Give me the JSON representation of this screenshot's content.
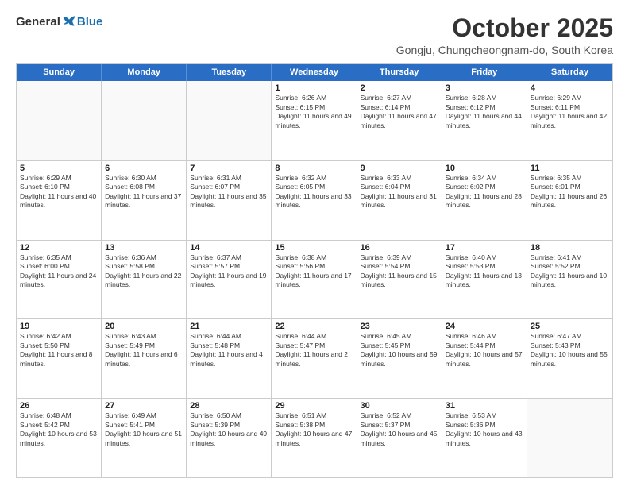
{
  "logo": {
    "general": "General",
    "blue": "Blue"
  },
  "title": "October 2025",
  "location": "Gongju, Chungcheongnam-do, South Korea",
  "header_days": [
    "Sunday",
    "Monday",
    "Tuesday",
    "Wednesday",
    "Thursday",
    "Friday",
    "Saturday"
  ],
  "weeks": [
    [
      {
        "day": "",
        "info": ""
      },
      {
        "day": "",
        "info": ""
      },
      {
        "day": "",
        "info": ""
      },
      {
        "day": "1",
        "info": "Sunrise: 6:26 AM\nSunset: 6:15 PM\nDaylight: 11 hours and 49 minutes."
      },
      {
        "day": "2",
        "info": "Sunrise: 6:27 AM\nSunset: 6:14 PM\nDaylight: 11 hours and 47 minutes."
      },
      {
        "day": "3",
        "info": "Sunrise: 6:28 AM\nSunset: 6:12 PM\nDaylight: 11 hours and 44 minutes."
      },
      {
        "day": "4",
        "info": "Sunrise: 6:29 AM\nSunset: 6:11 PM\nDaylight: 11 hours and 42 minutes."
      }
    ],
    [
      {
        "day": "5",
        "info": "Sunrise: 6:29 AM\nSunset: 6:10 PM\nDaylight: 11 hours and 40 minutes."
      },
      {
        "day": "6",
        "info": "Sunrise: 6:30 AM\nSunset: 6:08 PM\nDaylight: 11 hours and 37 minutes."
      },
      {
        "day": "7",
        "info": "Sunrise: 6:31 AM\nSunset: 6:07 PM\nDaylight: 11 hours and 35 minutes."
      },
      {
        "day": "8",
        "info": "Sunrise: 6:32 AM\nSunset: 6:05 PM\nDaylight: 11 hours and 33 minutes."
      },
      {
        "day": "9",
        "info": "Sunrise: 6:33 AM\nSunset: 6:04 PM\nDaylight: 11 hours and 31 minutes."
      },
      {
        "day": "10",
        "info": "Sunrise: 6:34 AM\nSunset: 6:02 PM\nDaylight: 11 hours and 28 minutes."
      },
      {
        "day": "11",
        "info": "Sunrise: 6:35 AM\nSunset: 6:01 PM\nDaylight: 11 hours and 26 minutes."
      }
    ],
    [
      {
        "day": "12",
        "info": "Sunrise: 6:35 AM\nSunset: 6:00 PM\nDaylight: 11 hours and 24 minutes."
      },
      {
        "day": "13",
        "info": "Sunrise: 6:36 AM\nSunset: 5:58 PM\nDaylight: 11 hours and 22 minutes."
      },
      {
        "day": "14",
        "info": "Sunrise: 6:37 AM\nSunset: 5:57 PM\nDaylight: 11 hours and 19 minutes."
      },
      {
        "day": "15",
        "info": "Sunrise: 6:38 AM\nSunset: 5:56 PM\nDaylight: 11 hours and 17 minutes."
      },
      {
        "day": "16",
        "info": "Sunrise: 6:39 AM\nSunset: 5:54 PM\nDaylight: 11 hours and 15 minutes."
      },
      {
        "day": "17",
        "info": "Sunrise: 6:40 AM\nSunset: 5:53 PM\nDaylight: 11 hours and 13 minutes."
      },
      {
        "day": "18",
        "info": "Sunrise: 6:41 AM\nSunset: 5:52 PM\nDaylight: 11 hours and 10 minutes."
      }
    ],
    [
      {
        "day": "19",
        "info": "Sunrise: 6:42 AM\nSunset: 5:50 PM\nDaylight: 11 hours and 8 minutes."
      },
      {
        "day": "20",
        "info": "Sunrise: 6:43 AM\nSunset: 5:49 PM\nDaylight: 11 hours and 6 minutes."
      },
      {
        "day": "21",
        "info": "Sunrise: 6:44 AM\nSunset: 5:48 PM\nDaylight: 11 hours and 4 minutes."
      },
      {
        "day": "22",
        "info": "Sunrise: 6:44 AM\nSunset: 5:47 PM\nDaylight: 11 hours and 2 minutes."
      },
      {
        "day": "23",
        "info": "Sunrise: 6:45 AM\nSunset: 5:45 PM\nDaylight: 10 hours and 59 minutes."
      },
      {
        "day": "24",
        "info": "Sunrise: 6:46 AM\nSunset: 5:44 PM\nDaylight: 10 hours and 57 minutes."
      },
      {
        "day": "25",
        "info": "Sunrise: 6:47 AM\nSunset: 5:43 PM\nDaylight: 10 hours and 55 minutes."
      }
    ],
    [
      {
        "day": "26",
        "info": "Sunrise: 6:48 AM\nSunset: 5:42 PM\nDaylight: 10 hours and 53 minutes."
      },
      {
        "day": "27",
        "info": "Sunrise: 6:49 AM\nSunset: 5:41 PM\nDaylight: 10 hours and 51 minutes."
      },
      {
        "day": "28",
        "info": "Sunrise: 6:50 AM\nSunset: 5:39 PM\nDaylight: 10 hours and 49 minutes."
      },
      {
        "day": "29",
        "info": "Sunrise: 6:51 AM\nSunset: 5:38 PM\nDaylight: 10 hours and 47 minutes."
      },
      {
        "day": "30",
        "info": "Sunrise: 6:52 AM\nSunset: 5:37 PM\nDaylight: 10 hours and 45 minutes."
      },
      {
        "day": "31",
        "info": "Sunrise: 6:53 AM\nSunset: 5:36 PM\nDaylight: 10 hours and 43 minutes."
      },
      {
        "day": "",
        "info": ""
      }
    ]
  ]
}
